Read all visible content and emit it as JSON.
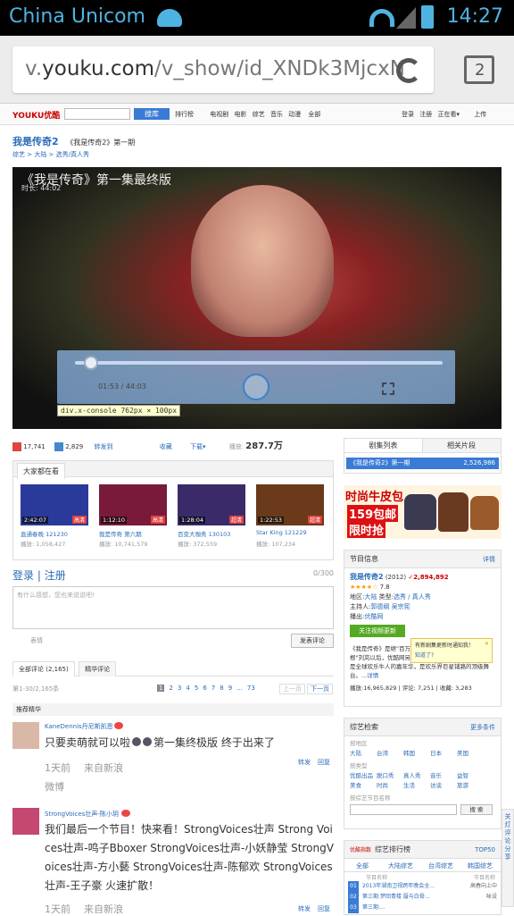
{
  "status": {
    "carrier": "China Unicom",
    "time": "14:27"
  },
  "browser": {
    "url_prefix": "v.",
    "url_host": "youku.com",
    "url_path": "/v_show/id_XNDk3MjcxN",
    "tab_count": "2"
  },
  "nav": {
    "logo": "YOUKU优酷",
    "search_btn": "搜库",
    "links": [
      "排行榜",
      "电视剧",
      "电影",
      "综艺",
      "音乐",
      "动漫",
      "全部"
    ],
    "right": [
      "登录",
      "注册",
      "正在看▾",
      "上传"
    ]
  },
  "page": {
    "title": "我是传奇2",
    "subtitle": "《我是传奇2》第一期",
    "breadcrumb": "综艺 > 大陆 > 选秀/真人秀"
  },
  "video": {
    "title": "《我是传奇》第一集最终版",
    "duration": "时长: 44:02",
    "time": "01:53 / 44:03",
    "progress": 0.043,
    "inspector_label": "div.x-console",
    "inspector_size": "762px × 100px"
  },
  "actions": {
    "likes": "17,741",
    "dislikes": "2,829",
    "share": "转发到",
    "collect": "收藏",
    "download": "下载▾",
    "plays_label": "播放:",
    "plays": "287.7万"
  },
  "watching": {
    "tab": "大家都在看",
    "items": [
      {
        "dur": "2:42:07",
        "badge": "高清",
        "title": "直通春晚 121230",
        "plays": "播放: 1,058,427"
      },
      {
        "dur": "1:12:10",
        "badge": "高清",
        "title": "我是传奇 第六期",
        "plays": "播放: 10,741,579"
      },
      {
        "dur": "1:28:04",
        "badge": "超清",
        "title": "百变大咖秀 130103",
        "plays": "播放: 372,559"
      },
      {
        "dur": "1:22:53",
        "badge": "超清",
        "title": "Star King 121229",
        "plays": "播放: 107,234"
      }
    ]
  },
  "comment": {
    "login": "登录",
    "register": "注册",
    "count": "0/300",
    "placeholder": "有什么感想，您也来说说吧!",
    "emoji": "表情",
    "submit": "发表评论",
    "tabs": [
      "全部评论 (2,165)",
      "精华评论"
    ],
    "range": "第1-30/2,165条",
    "pages": [
      "1",
      "2",
      "3",
      "4",
      "5",
      "6",
      "7",
      "8",
      "9",
      "...",
      "73"
    ],
    "prev": "上一页",
    "next": "下一页",
    "highlight": "推荐精华"
  },
  "comments": [
    {
      "user": "KaneDennis丹尼斯凯恩",
      "text": "只要卖萌就可以啦",
      "text2": "第一集终极版 终于出来了",
      "time": "1天前",
      "source": "来自新浪",
      "source2": "微博",
      "forward": "转发",
      "reply": "回复"
    },
    {
      "user": "StrongVoices壮声-陈小玥",
      "text": "我们最后一个节目！快来看！StrongVoices壮声 Strong Voices壮声-鸣子Bboxer StrongVoices壮声-小妖静莹 StrongVoices壮声-方小藝 StrongVoices壮声-陈郁欢 StrongVoices壮声-王子豪 火速扩散！",
      "time": "1天前",
      "source": "来自新浪",
      "forward": "转发",
      "reply": "回复"
    }
  ],
  "playlist": {
    "tabs": [
      "剧集列表",
      "相关片段"
    ],
    "item": "《我是传奇2》第一期",
    "plays": "2,526,986"
  },
  "ad": {
    "line1": "时尚牛皮包",
    "line2": "159包邮",
    "line3": "限时抢"
  },
  "info": {
    "title": "节目信息",
    "detail": "详情",
    "name": "我是传奇2",
    "year": "(2012)",
    "plays": "2,894,892",
    "rating": "7.8",
    "region_label": "地区:",
    "region": "大陆",
    "type_label": "类型:",
    "types": "选秀 / 真人秀",
    "host_label": "主持人:",
    "hosts": "郭德纲 吴宗宪",
    "station_label": "播出:",
    "station": "优酷网",
    "follow": "关注视频更新",
    "tip1": "有新剧集更新时通知我！",
    "tip2": "知道了?",
    "desc": "《我是传奇》是继\"百万富翁\"周立波、周日蔡、\"我是草根\"刘岚以后，优酷网另一爆火收视节目。《我是传奇2》是全球欢乐牛人的嘉年华，是欢乐界巨星铺路的顶级舞台。...",
    "more": "详情",
    "stats": "播放:16,965,829 | 评论: 7,251 | 收藏: 3,283"
  },
  "variety": {
    "title": "综艺检索",
    "more": "更多条件",
    "region_label": "按地区",
    "regions": [
      "大陆",
      "台湾",
      "韩国",
      "日本",
      "美国"
    ],
    "type_label": "按类型",
    "types": [
      "优酷出品",
      "脱口秀",
      "真人秀",
      "音乐",
      "益智",
      "美食",
      "时尚",
      "生活",
      "访谈",
      "旅游"
    ],
    "search_label": "按综艺节目名称",
    "search_btn": "搜 索"
  },
  "rank": {
    "title": "综艺排行榜",
    "top": "TOP50",
    "logo": "优酷指数",
    "tabs": [
      "全部",
      "大陆综艺",
      "台湾综艺",
      "韩国综艺"
    ],
    "col1": "节目名称",
    "col2": "节目名称",
    "items": [
      {
        "n": "01",
        "t": "2013年湖南卫视跨年晚会全...",
        "h": "高春向上中"
      },
      {
        "n": "02",
        "t": "第三期:梦回青楼 蜃与白骨...",
        "h": "咏设"
      },
      {
        "n": "03",
        "t": "第三期:...",
        "h": ""
      }
    ]
  },
  "float": {
    "label": "关灯 评论 分享"
  }
}
